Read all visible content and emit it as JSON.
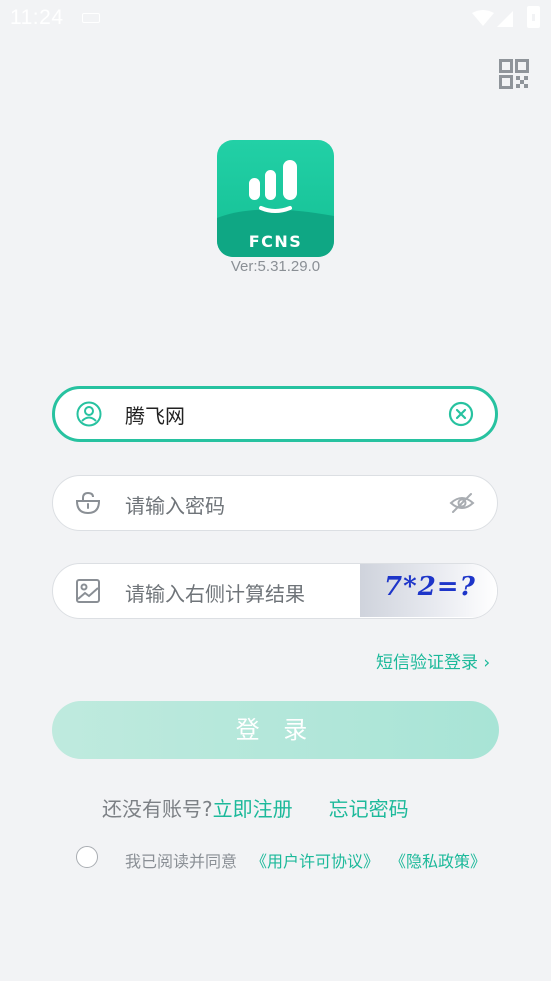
{
  "status_bar": {
    "time": "11:24"
  },
  "logo": {
    "text": "FCNS"
  },
  "version": "Ver:5.31.29.0",
  "fields": {
    "username": {
      "value": "腾飞网"
    },
    "password": {
      "placeholder": "请输入密码"
    },
    "captcha": {
      "placeholder": "请输入右侧计算结果",
      "image_text": "7*2=?"
    }
  },
  "sms_login": "短信验证登录 ›",
  "login_button": "登 录",
  "bottom": {
    "no_account": "还没有账号?",
    "register": "立即注册",
    "forgot": "忘记密码"
  },
  "agreement": {
    "text": "我已阅读并同意",
    "user_license": "《用户许可协议》",
    "privacy": "《隐私政策》"
  },
  "colors": {
    "accent": "#27c2a0",
    "link": "#1cb99a",
    "background": "#f2f3f5",
    "captcha_text": "#1d35c9"
  }
}
